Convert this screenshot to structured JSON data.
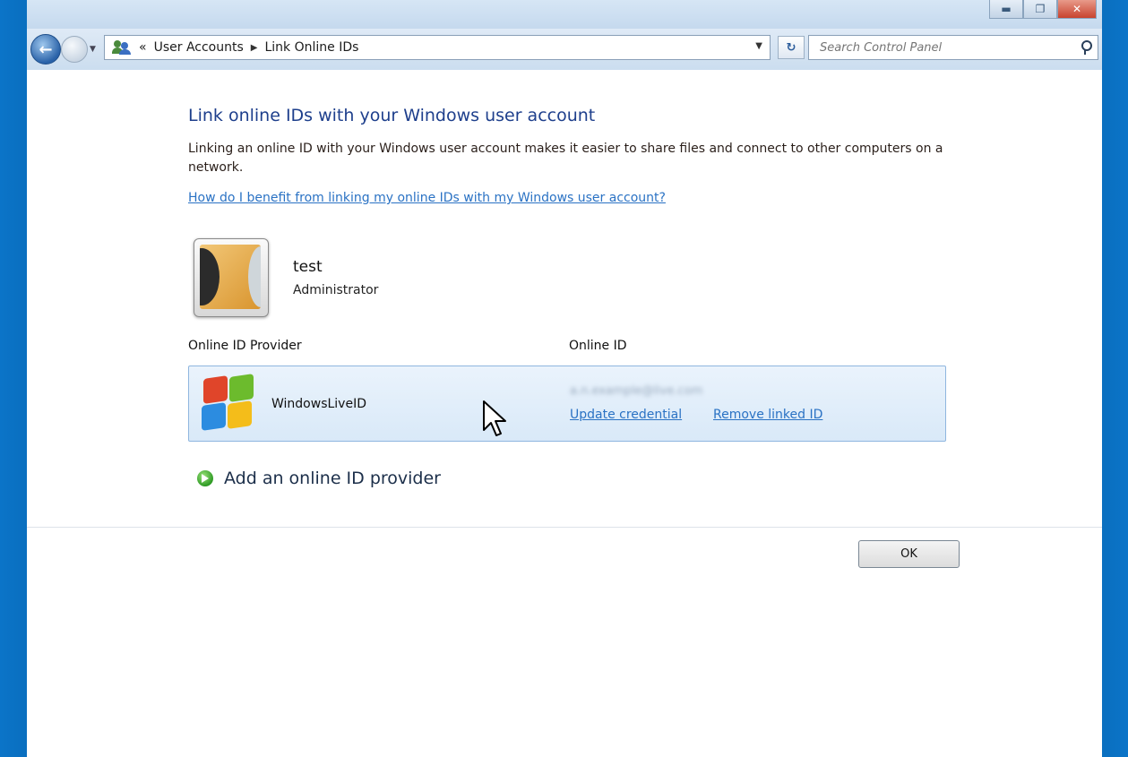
{
  "address_bar": {
    "overflow_chevron": "«",
    "breadcrumb": [
      "User Accounts",
      "Link Online IDs"
    ]
  },
  "search": {
    "placeholder": "Search Control Panel"
  },
  "page": {
    "title": "Link online IDs with your Windows user account",
    "description": "Linking an online ID with your Windows user account makes it easier to share files and connect to other computers on a network.",
    "help_link": "How do I benefit from linking my online IDs with my Windows user account?"
  },
  "user": {
    "name": "test",
    "role": "Administrator"
  },
  "table": {
    "columns": [
      "Online ID Provider",
      "Online ID"
    ],
    "rows": [
      {
        "provider": "WindowsLiveID",
        "online_id": "a.n.example@live.com",
        "actions": [
          "Update credential",
          "Remove linked ID"
        ]
      }
    ]
  },
  "add_provider_label": "Add an online ID provider",
  "ok_label": "OK",
  "colors": {
    "frame_blue": "#0a6fbf",
    "title_blue": "#1e3f8c",
    "link_blue": "#2a72c4",
    "row_highlight": "#dcebf9"
  },
  "icons": [
    "back-arrow-icon",
    "forward-arrow-icon",
    "user-accounts-icon",
    "refresh-icon",
    "search-icon",
    "windows-logo-icon",
    "green-arrow-icon",
    "mouse-cursor"
  ]
}
